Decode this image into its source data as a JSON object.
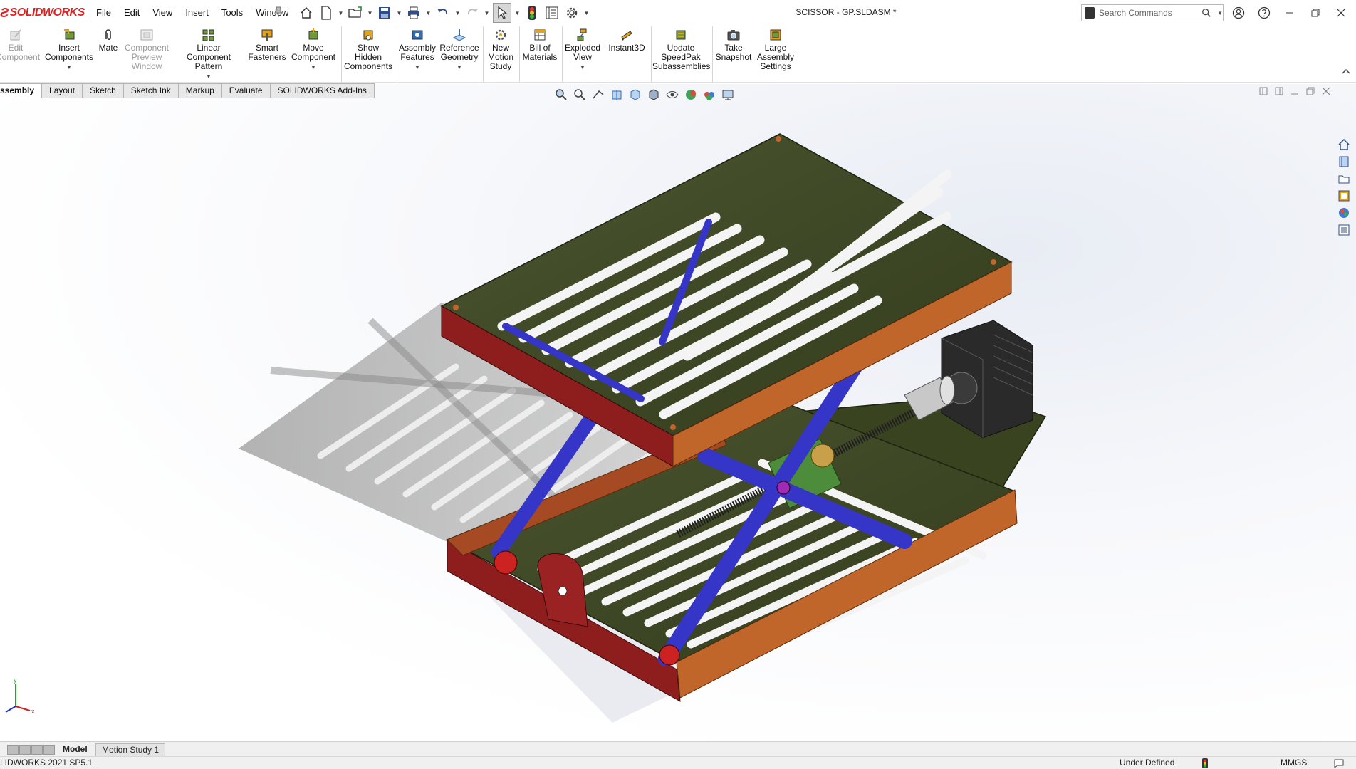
{
  "app": {
    "brand": "SOLIDWORKS",
    "document_title": "SCISSOR - GP.SLDASM *"
  },
  "menu": [
    "File",
    "Edit",
    "View",
    "Insert",
    "Tools",
    "Window"
  ],
  "search": {
    "placeholder": "Search Commands"
  },
  "commands": [
    {
      "label_lines": [
        "Edit",
        "Component"
      ],
      "disabled": true,
      "dropdown": false
    },
    {
      "label_lines": [
        "Insert",
        "Components"
      ],
      "disabled": false,
      "dropdown": true
    },
    {
      "label_lines": [
        "Mate"
      ],
      "disabled": false,
      "dropdown": false
    },
    {
      "label_lines": [
        "Component",
        "Preview",
        "Window"
      ],
      "disabled": true,
      "dropdown": false
    },
    {
      "label_lines": [
        "Linear Component",
        "Pattern"
      ],
      "disabled": false,
      "dropdown": true
    },
    {
      "label_lines": [
        "Smart",
        "Fasteners"
      ],
      "disabled": false,
      "dropdown": false
    },
    {
      "label_lines": [
        "Move",
        "Component"
      ],
      "disabled": false,
      "dropdown": true
    },
    {
      "label_lines": [
        "Show",
        "Hidden",
        "Components"
      ],
      "disabled": false,
      "dropdown": false
    },
    {
      "label_lines": [
        "Assembly",
        "Features"
      ],
      "disabled": false,
      "dropdown": true
    },
    {
      "label_lines": [
        "Reference",
        "Geometry"
      ],
      "disabled": false,
      "dropdown": true
    },
    {
      "label_lines": [
        "New",
        "Motion",
        "Study"
      ],
      "disabled": false,
      "dropdown": false
    },
    {
      "label_lines": [
        "Bill of",
        "Materials"
      ],
      "disabled": false,
      "dropdown": false
    },
    {
      "label_lines": [
        "Exploded",
        "View"
      ],
      "disabled": false,
      "dropdown": true
    },
    {
      "label_lines": [
        "Instant3D"
      ],
      "disabled": false,
      "dropdown": false
    },
    {
      "label_lines": [
        "Update",
        "SpeedPak",
        "Subassemblies"
      ],
      "disabled": false,
      "dropdown": false
    },
    {
      "label_lines": [
        "Take",
        "Snapshot"
      ],
      "disabled": false,
      "dropdown": false
    },
    {
      "label_lines": [
        "Large",
        "Assembly",
        "Settings"
      ],
      "disabled": false,
      "dropdown": false
    }
  ],
  "tabs": [
    "Assembly",
    "Layout",
    "Sketch",
    "Sketch Ink",
    "Markup",
    "Evaluate",
    "SOLIDWORKS Add-Ins"
  ],
  "tabs_visible_text": [
    "ssembly",
    "Layout",
    "Sketch",
    "Sketch Ink",
    "Markup",
    "Evaluate",
    "SOLIDWORKS Add-Ins"
  ],
  "active_tab": "Assembly",
  "bottom_tabs": [
    "Model",
    "Motion Study 1"
  ],
  "status": {
    "version": "LIDWORKS 2021 SP5.1",
    "definition": "Under Defined",
    "units": "MMGS"
  },
  "triad": {
    "x": "x",
    "y": "y"
  },
  "colors": {
    "brand": "#dd2222",
    "plate": "#3a4320",
    "frame_red": "#8e1e1e",
    "frame_orange": "#c0662a",
    "linkage": "#3535c8",
    "screw": "#222222"
  }
}
